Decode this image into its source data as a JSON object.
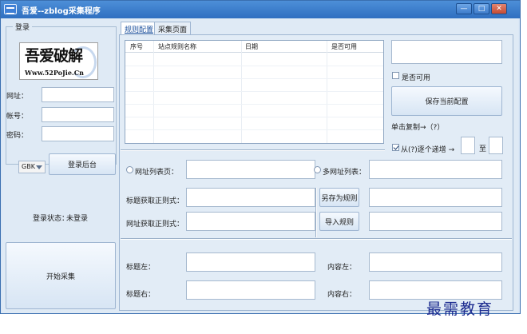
{
  "window": {
    "title": "吾爱--zblog采集程序",
    "minimize": "—",
    "maximize": "□",
    "close": "✕"
  },
  "login": {
    "group_title": "登录",
    "logo_main": "吾爱破解",
    "logo_sub": "Www.52PoJie.Cn",
    "url_label": "网址：",
    "url_value": "",
    "account_label": "帐号：",
    "account_value": "",
    "password_label": "密码：",
    "password_value": "",
    "encoding": "GBK",
    "login_button": "登录后台",
    "status_label": "登录状态：",
    "status_value": "未登录",
    "start_button": "开始采集"
  },
  "tabs": [
    {
      "label": "规则配置",
      "active": true
    },
    {
      "label": "采集页面",
      "active": false
    }
  ],
  "rules_table": {
    "columns": [
      "序号",
      "站点规则名称",
      "日期",
      "是否可用"
    ],
    "rows": []
  },
  "side": {
    "rule_name_value": "",
    "enabled_label": "是否可用",
    "enabled_checked": false,
    "save_button": "保存当前配置",
    "copy_hint": "单击复制→（?）",
    "increment_checked": true,
    "increment_label": "从(?)逐个递增 →",
    "from_value": "",
    "to_label": "至",
    "to_value": ""
  },
  "form": {
    "url_list_page_label": "网址列表页：",
    "url_list_page_value": "",
    "multi_url_label": "多网址列表：",
    "multi_url_value": "",
    "title_regex_label": "标题获取正则式：",
    "title_regex_value": "",
    "save_as_rule_button": "另存为规则",
    "save_as_value": "",
    "url_regex_label": "网址获取正则式：",
    "url_regex_value": "",
    "import_rule_button": "导入规则",
    "import_value": "",
    "title_left_label": "标题左：",
    "title_left_value": "",
    "content_left_label": "内容左：",
    "content_left_value": "",
    "title_right_label": "标题右：",
    "title_right_value": "",
    "content_right_label": "内容右：",
    "content_right_value": ""
  },
  "watermark": "最需教育"
}
